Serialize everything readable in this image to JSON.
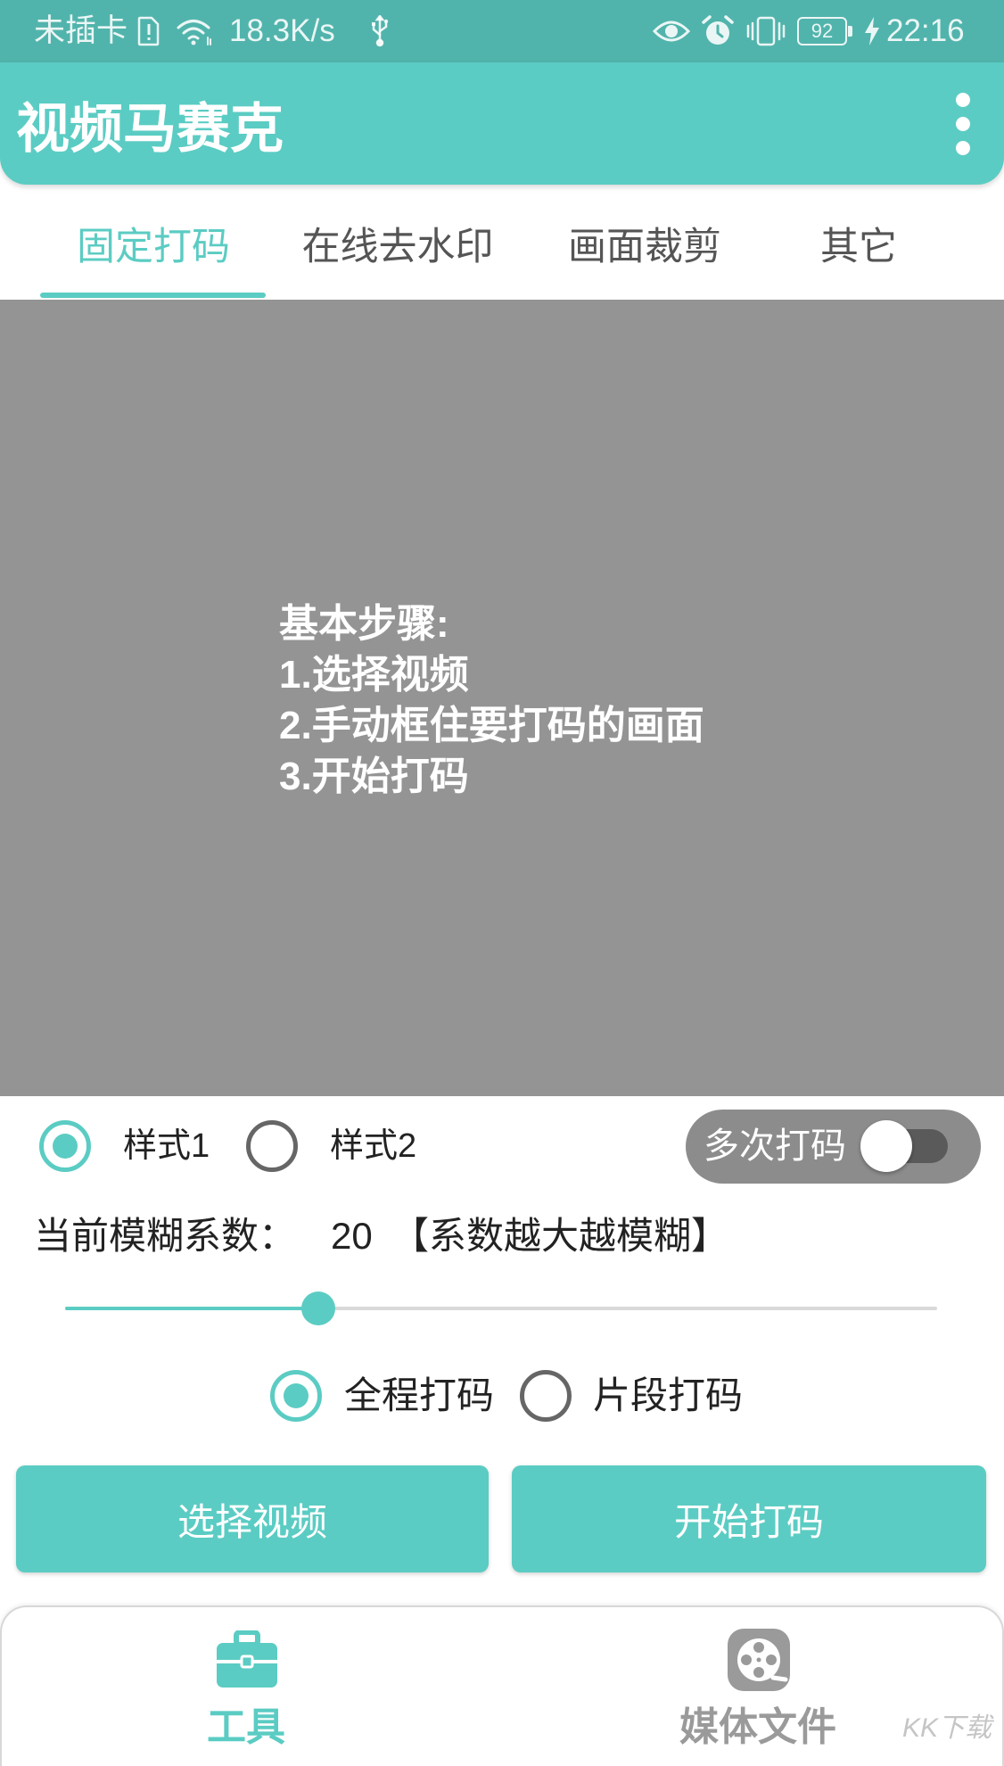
{
  "status_bar": {
    "carrier": "未插卡",
    "speed": "18.3K/s",
    "battery": "92",
    "time": "22:16",
    "icons": [
      "sim-card-icon",
      "wifi-icon",
      "usb-icon",
      "eye-icon",
      "alarm-icon",
      "vibrate-icon",
      "battery-icon",
      "charging-icon"
    ]
  },
  "app_bar": {
    "title": "视频马赛克",
    "menu_icon": "more-vert-icon"
  },
  "tabs": [
    {
      "label": "固定打码",
      "active": true
    },
    {
      "label": "在线去水印",
      "active": false
    },
    {
      "label": "画面裁剪",
      "active": false
    },
    {
      "label": "其它",
      "active": false
    }
  ],
  "preview": {
    "lines": [
      "基本步骤:",
      "1.选择视频",
      "2.手动框住要打码的画面",
      "3.开始打码"
    ]
  },
  "style_options": [
    {
      "label": "样式1",
      "checked": true
    },
    {
      "label": "样式2",
      "checked": false
    }
  ],
  "multi_toggle": {
    "label": "多次打码",
    "on": false
  },
  "blur": {
    "label": "当前模糊系数：",
    "value": "20",
    "hint": "【系数越大越模糊】",
    "level": 0.29
  },
  "range_options": [
    {
      "label": "全程打码",
      "checked": true
    },
    {
      "label": "片段打码",
      "checked": false
    }
  ],
  "buttons": {
    "select_video": "选择视频",
    "start_mosaic": "开始打码"
  },
  "bottom_nav": [
    {
      "label": "工具",
      "icon": "briefcase-icon",
      "active": true
    },
    {
      "label": "媒体文件",
      "icon": "film-reel-icon",
      "active": false
    }
  ],
  "watermark": "KK下载",
  "colors": {
    "accent": "#5bccc3",
    "status": "#51b4ac",
    "preview": "#949494",
    "toggle": "#8c8c8c",
    "text": "#222222",
    "tab-inactive": "#555555",
    "nav-inactive": "#9a9a9a"
  }
}
